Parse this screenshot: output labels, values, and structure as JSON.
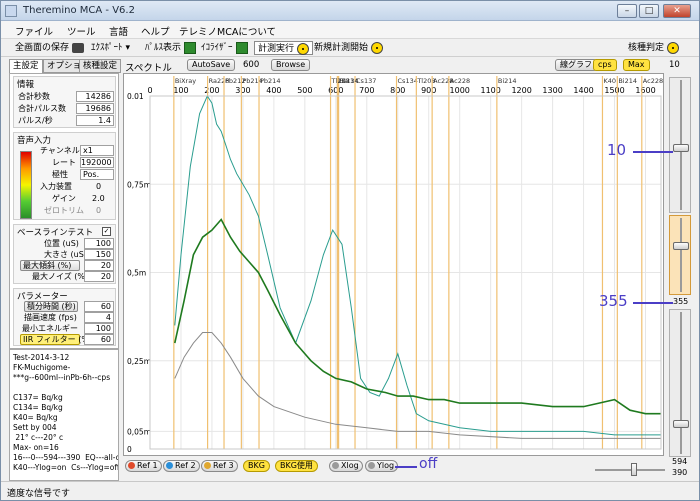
{
  "window": {
    "title": "Theremino MCA - V6.2"
  },
  "menu": [
    "ファイル",
    "ツール",
    "言語",
    "ヘルプ",
    "テレミノMCAについて"
  ],
  "toolbar": {
    "save_screen": "全画面の保存",
    "export": "ｴｸｽﾎﾟｰﾄ",
    "pulse_display": "ﾊﾟﾙｽ表示",
    "equalizer": "ｲｺﾗｲｻﾞｰ",
    "run_measure": "計測実行",
    "new_measure": "新規計測開始",
    "nuclide_id": "核種判定"
  },
  "tabs": [
    "主設定",
    "オプション",
    "核種設定"
  ],
  "info": {
    "title": "情報",
    "total_seconds_label": "合計秒数",
    "total_seconds": "14286",
    "total_pulses_label": "合計パルス数",
    "total_pulses": "19686",
    "pulses_per_sec_label": "パルス/秒",
    "pulses_per_sec": "1.4"
  },
  "audio": {
    "title": "音声入力",
    "channel_label": "チャンネル",
    "channel": "x1",
    "rate_label": "レート",
    "rate": "192000",
    "polarity_label": "極性",
    "polarity": "Pos.",
    "device_label": "入力装置",
    "device": "0",
    "gain_label": "ゲイン",
    "gain": "2.0",
    "zero_trim_label": "ゼロトリム",
    "zero_trim": "0"
  },
  "baseline": {
    "title": "ベースラインテスト",
    "position_label": "位置 (uS)",
    "position": "100",
    "size_label": "大きさ (uS)",
    "size": "150",
    "max_slope_label": "最大傾斜 (%)",
    "max_slope": "20",
    "max_noise_label": "最大ノイズ (%)",
    "max_noise": "20"
  },
  "params": {
    "title": "パラメーター",
    "integration_label": "積分時間 (秒)",
    "integration": "60",
    "draw_speed_label": "描画速度 (fps)",
    "draw_speed": "4",
    "min_energy_label": "最小エネルギー",
    "min_energy": "100",
    "iir_label": "IIR フィルター (%)",
    "iir": "60"
  },
  "notes": "Test-2014-3-12\nFK-Muchigome-\n***g--600ml--inPb-6h--cps\n\nC137= Bq/kg\nC134= Bq/kg\nK40= Bq/kg\nSett by 004\n 21° c---20° c\nMax- on=16\n16---0---594---390  EQ---all-on\nK40---Ylog=on  Cs---Ylog=off",
  "chart_header": {
    "title": "スペクトル",
    "autosave": "AutoSave",
    "autosave_value": "600",
    "browse": "Browse",
    "line_graph": "線グラフ",
    "cps": "cps",
    "max": "Max",
    "right_value": "10"
  },
  "chart_data": {
    "type": "line",
    "x_ticks": [
      "0",
      "100",
      "200",
      "300",
      "400",
      "500",
      "600",
      "700",
      "800",
      "900",
      "1000",
      "1100",
      "1200",
      "1300",
      "1400",
      "1500",
      "1600"
    ],
    "y_ticks": [
      "0.01",
      "0,75m",
      "0,5m",
      "0,25m",
      "0,05m",
      "0"
    ],
    "xlim": [
      0,
      1650
    ],
    "ylim": [
      0,
      1
    ],
    "isotope_markers": [
      {
        "label": "BiXray",
        "x": 77
      },
      {
        "label": "Ra226",
        "x": 186
      },
      {
        "label": "Pb212",
        "x": 239
      },
      {
        "label": "Pb214",
        "x": 295
      },
      {
        "label": "Pb214",
        "x": 352
      },
      {
        "label": "Bi214",
        "x": 609
      },
      {
        "label": "Cs137",
        "x": 662
      },
      {
        "label": "Tl208",
        "x": 583
      },
      {
        "label": "Cs134",
        "x": 605
      },
      {
        "label": "Cs134",
        "x": 796
      },
      {
        "label": "Tl208",
        "x": 860
      },
      {
        "label": "Ac228",
        "x": 911
      },
      {
        "label": "Ac228",
        "x": 965
      },
      {
        "label": "Bi214",
        "x": 1120
      },
      {
        "label": "K40",
        "x": 1461
      },
      {
        "label": "Bi214",
        "x": 1509
      },
      {
        "label": "Ac228",
        "x": 1588
      }
    ],
    "series": [
      {
        "color": "#2a9d8f",
        "x": [
          80,
          100,
          130,
          160,
          185,
          200,
          215,
          230,
          245,
          260,
          280,
          300,
          320,
          350,
          380,
          420,
          470,
          520,
          560,
          590,
          620,
          650,
          680,
          710,
          740,
          770,
          800,
          830,
          860,
          900,
          950,
          1000,
          1100,
          1200,
          1300,
          1400,
          1500,
          1600,
          1650
        ],
        "y": [
          0.35,
          0.55,
          0.8,
          0.95,
          1.0,
          0.98,
          0.92,
          0.9,
          0.86,
          0.82,
          0.78,
          0.75,
          0.72,
          0.66,
          0.55,
          0.4,
          0.3,
          0.42,
          0.55,
          0.62,
          0.58,
          0.4,
          0.2,
          0.16,
          0.15,
          0.2,
          0.27,
          0.18,
          0.1,
          0.08,
          0.07,
          0.06,
          0.05,
          0.05,
          0.05,
          0.05,
          0.04,
          0.04,
          0.04
        ]
      },
      {
        "color": "#1f7a1f",
        "x": [
          80,
          110,
          140,
          170,
          200,
          230,
          260,
          290,
          320,
          350,
          380,
          420,
          470,
          520,
          560,
          600,
          650,
          700,
          760,
          800,
          850,
          900,
          950,
          1000,
          1100,
          1200,
          1300,
          1400,
          1450,
          1500,
          1550,
          1600,
          1650
        ],
        "y": [
          0.3,
          0.42,
          0.55,
          0.6,
          0.62,
          0.65,
          0.6,
          0.56,
          0.53,
          0.5,
          0.45,
          0.38,
          0.3,
          0.25,
          0.22,
          0.2,
          0.19,
          0.17,
          0.16,
          0.15,
          0.15,
          0.14,
          0.14,
          0.13,
          0.13,
          0.13,
          0.12,
          0.12,
          0.13,
          0.14,
          0.11,
          0.1,
          0.1
        ]
      },
      {
        "color": "#8a8a8a",
        "x": [
          80,
          110,
          140,
          170,
          200,
          230,
          260,
          300,
          350,
          400,
          500,
          600,
          700,
          800,
          900,
          1000,
          1200,
          1400,
          1650
        ],
        "y": [
          0.2,
          0.26,
          0.3,
          0.33,
          0.33,
          0.3,
          0.26,
          0.2,
          0.15,
          0.12,
          0.09,
          0.07,
          0.06,
          0.05,
          0.05,
          0.04,
          0.03,
          0.03,
          0.03
        ]
      }
    ]
  },
  "bottom": {
    "ref1": "Ref 1",
    "ref2": "Ref 2",
    "ref3": "Ref 3",
    "bkg": "BKG",
    "bkg_use": "BKG使用",
    "xlog": "Xlog",
    "ylog": "Ylog",
    "off_annotation": "off",
    "h_value_top": "594",
    "h_value_bottom": "390"
  },
  "right": {
    "anno_10": "10",
    "anno_355": "355",
    "value_355": "355"
  },
  "status": "適度な信号です"
}
